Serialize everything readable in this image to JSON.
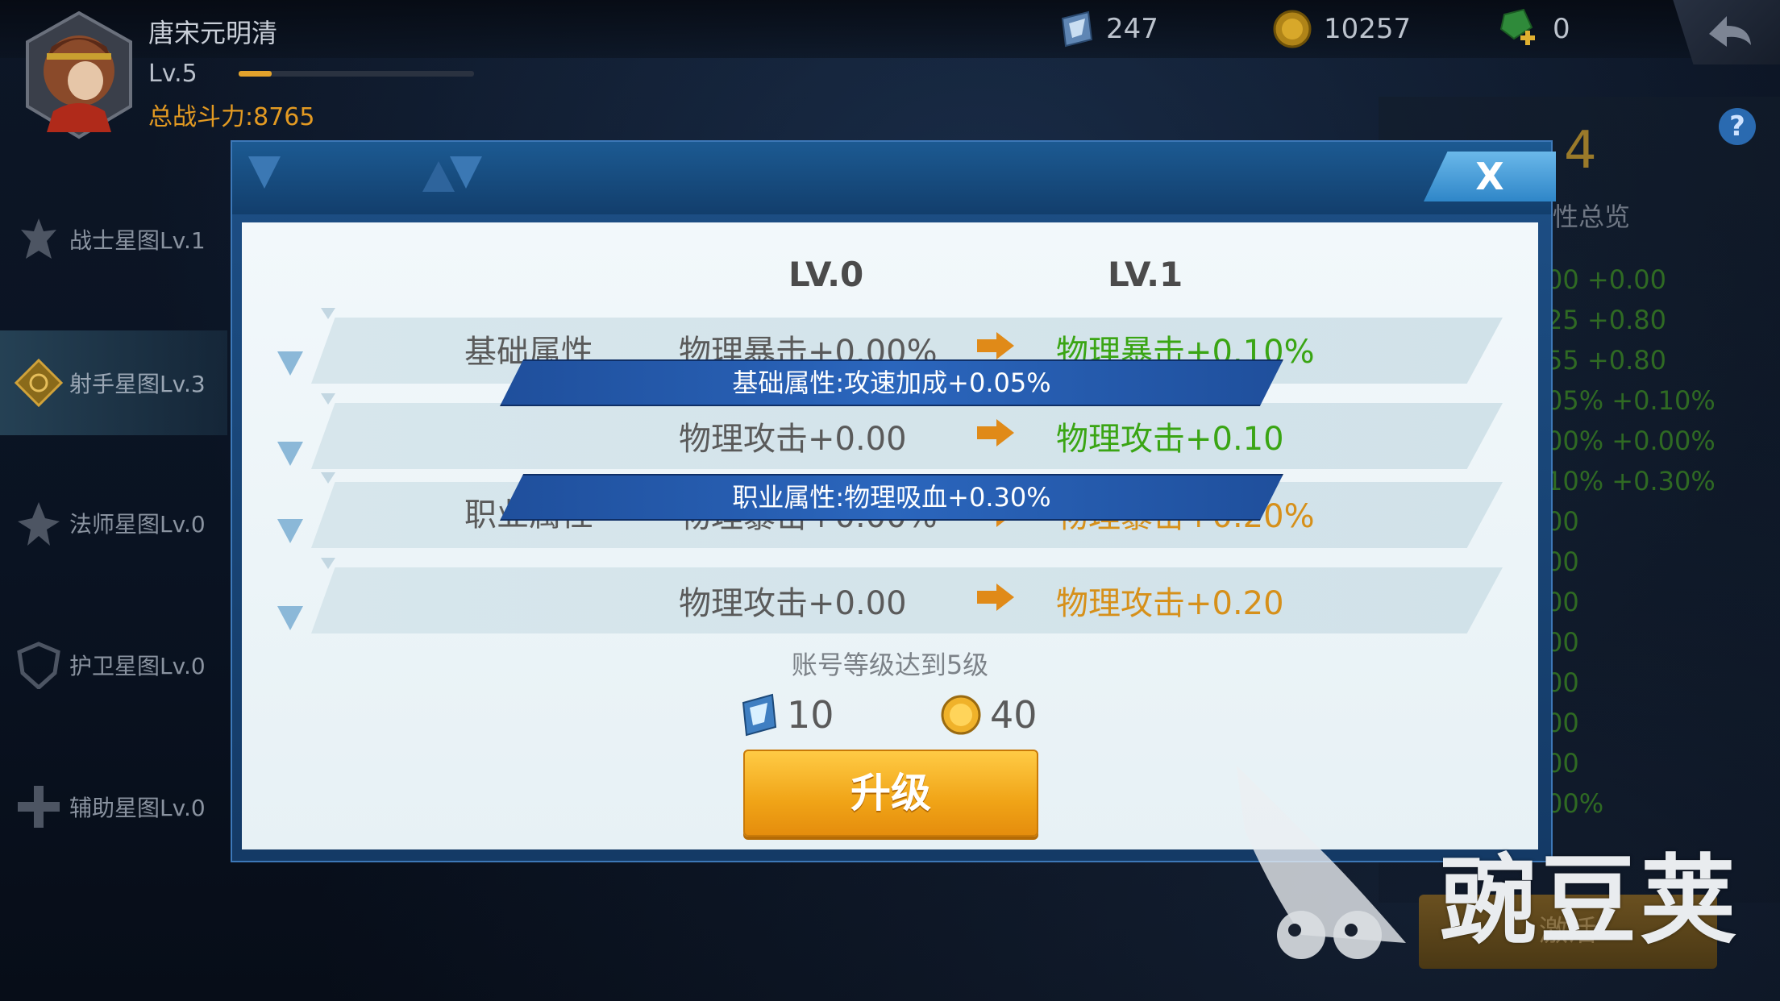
{
  "player": {
    "name": "唐宋元明清",
    "level": "Lv.5",
    "power": "总战斗力:8765",
    "xp_fraction": 0.14
  },
  "resources": [
    {
      "icon": "crystal-icon",
      "value": "247"
    },
    {
      "icon": "gold-coin-icon",
      "value": "10257"
    },
    {
      "icon": "green-gem-add-icon",
      "value": "0"
    }
  ],
  "sidebar": {
    "items": [
      {
        "label": "战士星图Lv.1",
        "icon": "warrior-icon"
      },
      {
        "label": "射手星图Lv.3",
        "icon": "archer-icon"
      },
      {
        "label": "法师星图Lv.0",
        "icon": "mage-icon"
      },
      {
        "label": "护卫星图Lv.0",
        "icon": "guardian-icon"
      },
      {
        "label": "辅助星图Lv.0",
        "icon": "support-icon"
      }
    ]
  },
  "right_panel": {
    "level_number": "4",
    "title": "性总览",
    "rows": [
      "00  +0.00",
      "25  +0.80",
      "55  +0.80",
      "05%  +0.10%",
      "00%  +0.00%",
      "10%  +0.30%",
      "00",
      "00",
      "00",
      "00",
      "00",
      "00",
      "00",
      "00%"
    ],
    "activate_label": "激活"
  },
  "modal": {
    "close_label": "X",
    "lv_from": "LV.0",
    "lv_to": "LV.1",
    "section_basic": "基础属性",
    "section_job": "职业属性",
    "rows": [
      {
        "from": "物理暴击+0.00%",
        "to": "物理暴击+0.10%"
      },
      {
        "from": "物理攻击+0.00",
        "to": "物理攻击+0.10"
      },
      {
        "from": "物理暴击+0.00%",
        "to": "物理暴击+0.20%"
      },
      {
        "from": "物理攻击+0.00",
        "to": "物理攻击+0.20"
      }
    ],
    "banner_basic": "基础属性:攻速加成+0.05%",
    "banner_job": "职业属性:物理吸血+0.30%",
    "requirement": "账号等级达到5级",
    "cost_crystal": "10",
    "cost_gold": "40",
    "upgrade_label": "升级"
  },
  "watermark": {
    "text": "豌豆荚"
  },
  "colors": {
    "green": "#3aa514",
    "orange": "#d6901a",
    "button": "#f0a417",
    "accent_blue": "#1f4f9c"
  }
}
